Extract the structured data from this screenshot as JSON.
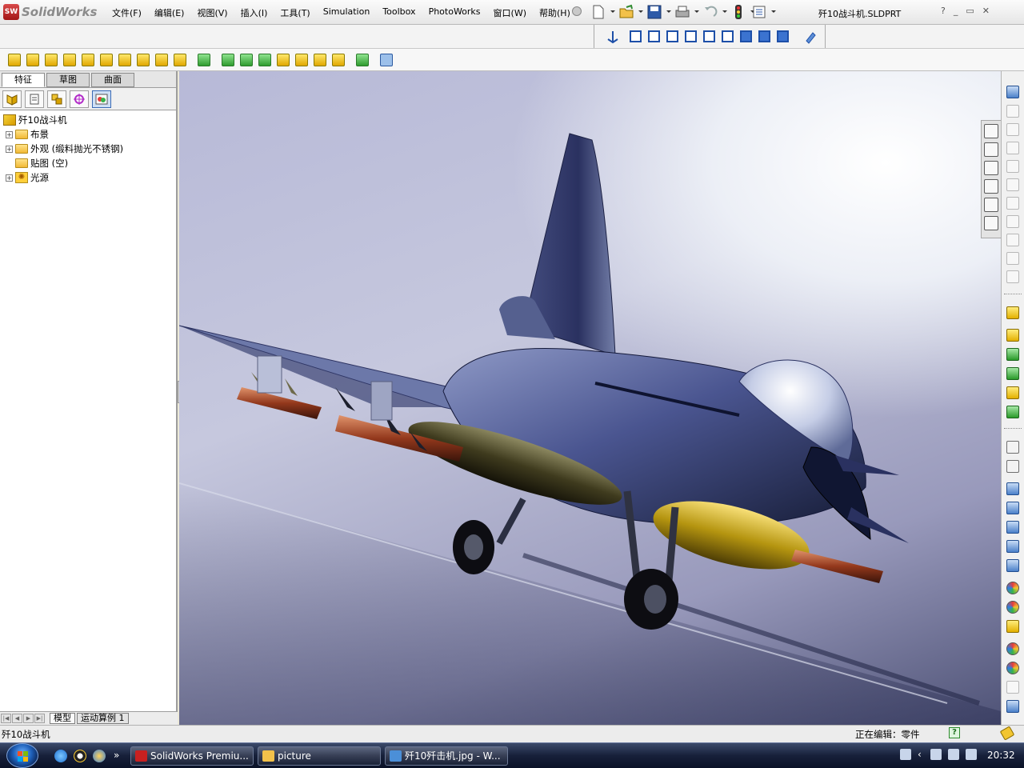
{
  "menubar": {
    "logo_badge": "SW",
    "logo_text": "SolidWorks",
    "menus": [
      "文件(F)",
      "编辑(E)",
      "视图(V)",
      "插入(I)",
      "工具(T)",
      "Simulation",
      "Toolbox",
      "PhotoWorks",
      "窗口(W)",
      "帮助(H)"
    ],
    "doc_title": "歼10战斗机.SLDPRT",
    "help_symbol": "?",
    "window_controls": [
      "_",
      "▭",
      "✕"
    ]
  },
  "feature_tree_tabs": [
    "特征",
    "草图",
    "曲面"
  ],
  "feature_tree": {
    "root": "歼10战斗机",
    "items": [
      {
        "label": "布景",
        "expandable": true
      },
      {
        "label": "外观 (缎料抛光不锈钢)",
        "expandable": true
      },
      {
        "label": "贴图 (空)",
        "expandable": false
      },
      {
        "label": "光源",
        "expandable": true
      }
    ]
  },
  "bottom_tabs": [
    "模型",
    "运动算例 1"
  ],
  "status": {
    "left": "歼10战斗机",
    "right": "正在编辑：零件",
    "help_icon": "?"
  },
  "taskbar": {
    "tasks": [
      {
        "label": "SolidWorks Premiu...",
        "icon": "solidworks-icon",
        "color": "#c82020"
      },
      {
        "label": "picture",
        "icon": "folder-icon",
        "color": "#f2c14a"
      },
      {
        "label": "歼10歼击机.jpg - W...",
        "icon": "image-viewer-icon",
        "color": "#4b8fd8"
      }
    ],
    "quicklaunch_more": "»",
    "clock": "20:32"
  },
  "colors": {
    "accent": "#3b73d0",
    "taskbar": "#17203a"
  }
}
